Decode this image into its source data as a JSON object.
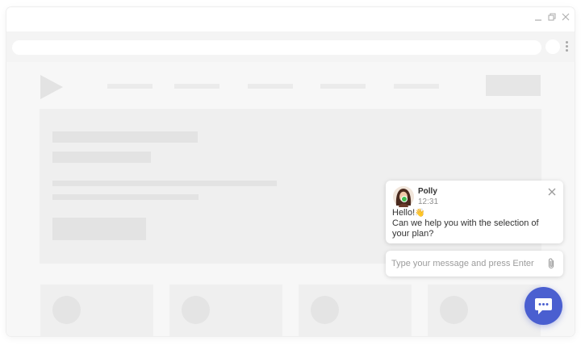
{
  "browser": {
    "window_controls": [
      "minimize-icon",
      "restore-icon",
      "close-icon"
    ],
    "address_bar_value": "",
    "colors": {
      "accent": "#4a5fd0",
      "online": "#3fbf4f"
    }
  },
  "chat": {
    "agent_name": "Polly",
    "time": "12:31",
    "greeting": "Hello!",
    "greeting_emoji": "👋",
    "message": "Can we help you with the selection of your plan?",
    "input_value": "",
    "input_placeholder": "Type your message and press Enter",
    "icons": {
      "close": "close-icon",
      "attach": "paperclip-icon",
      "launcher": "chat-icon"
    }
  }
}
